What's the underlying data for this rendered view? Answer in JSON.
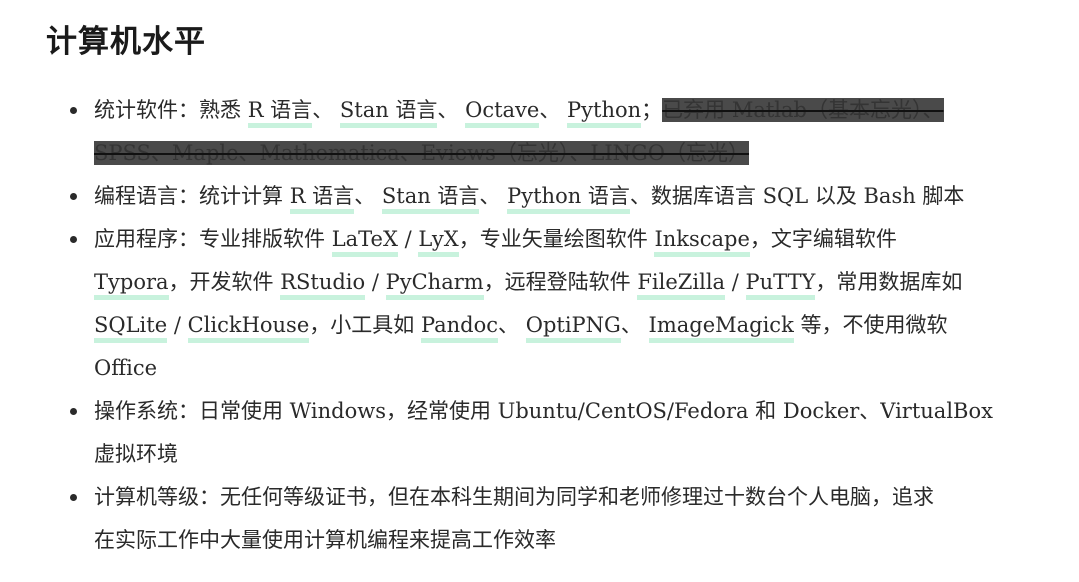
{
  "title": "计算机水平",
  "items": {
    "stats": {
      "label": "统计软件：",
      "intro": "熟悉 ",
      "r": "R 语言",
      "sep1": "、",
      "stan": "Stan 语言",
      "sep2": "、",
      "octave": "Octave",
      "sep3": "、",
      "python": "Python",
      "sep4": "；",
      "deleted_line1": "已弃用 Matlab（基本忘光）、",
      "deleted_line2": "SPSS、Maple、Mathematica、Eviews（忘光）、LINGO（忘光）"
    },
    "prog": {
      "label": "编程语言：",
      "intro": "统计计算 ",
      "r": "R 语言",
      "sep1": "、",
      "stan": "Stan 语言",
      "sep2": "、",
      "python": "Python 语言",
      "rest": "、数据库语言 SQL 以及 Bash 脚本"
    },
    "apps": {
      "label": "应用程序：",
      "t1": "专业排版软件 ",
      "latex": "LaTeX",
      "slash": " / ",
      "lyx": "LyX",
      "t2": "，专业矢量绘图软件 ",
      "inkscape": "Inkscape",
      "t3": "，文字编辑软件",
      "typora": "Typora",
      "t4": "，开发软件 ",
      "rstudio": "RStudio",
      "pycharm": "PyCharm",
      "t5": "，远程登陆软件 ",
      "filezilla": "FileZilla",
      "putty": "PuTTY",
      "t6": "，常用数据库如",
      "sqlite": "SQLite",
      "clickhouse": "ClickHouse",
      "t7": "，小工具如 ",
      "pandoc": "Pandoc",
      "sep": "、",
      "optipng": "OptiPNG",
      "imagemagick": "ImageMagick",
      "t8": " 等，不使用微软",
      "t9": "Office"
    },
    "os": {
      "label": "操作系统：",
      "line1": "日常使用 Windows，经常使用 Ubuntu/CentOS/Fedora 和 Docker、VirtualBox",
      "line2": "虚拟环境"
    },
    "level": {
      "label": "计算机等级：",
      "line1": "无任何等级证书，但在本科生期间为同学和老师修理过十数台个人电脑，追求",
      "line2": "在实际工作中大量使用计算机编程来提高工作效率"
    }
  }
}
